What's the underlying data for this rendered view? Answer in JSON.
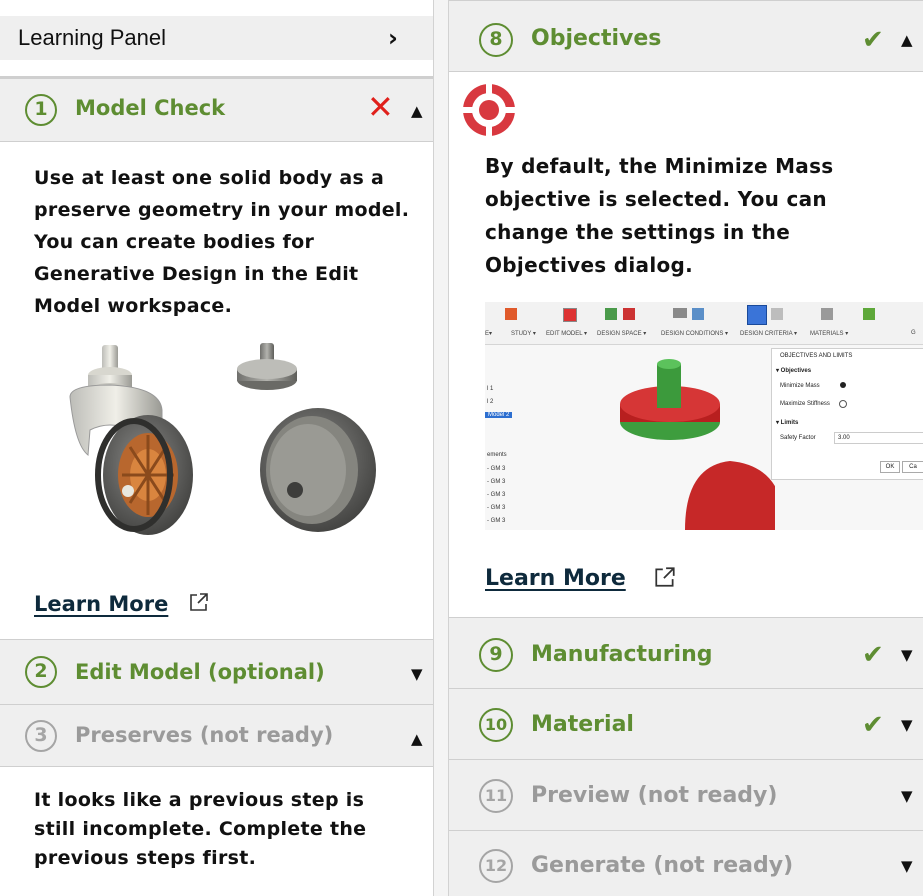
{
  "left": {
    "learning_panel_label": "Learning Panel",
    "model_check": {
      "number": "1",
      "title": "Model Check",
      "text": "Use at least one solid body as a preserve geometry in your model. You can create bodies for Generative Design in the Edit Model workspace.",
      "learn_more": "Learn More"
    },
    "edit_model": {
      "number": "2",
      "title": "Edit Model (optional)"
    },
    "preserves": {
      "number": "3",
      "title": "Preserves (not ready)",
      "text": "It looks like a previous step is still incomplete. Complete the previous steps first."
    }
  },
  "right": {
    "objectives": {
      "number": "8",
      "title": "Objectives",
      "text": "By default, the Minimize Mass objective is selected. You can change the settings in the Objectives dialog.",
      "learn_more": "Learn More",
      "screenshot": {
        "toolbar_labels": [
          "E▾",
          "STUDY ▾",
          "EDIT MODEL ▾",
          "DESIGN SPACE ▾",
          "DESIGN CONDITIONS ▾",
          "DESIGN CRITERIA ▾",
          "MATERIALS ▾",
          "G"
        ],
        "browser_items": [
          "l 1",
          "l 2",
          "Model 2",
          "ements",
          "- GM 3",
          "- GM 3",
          "- GM 3",
          "- GM 3",
          "- GM 3"
        ],
        "dialog": {
          "title": "OBJECTIVES AND LIMITS",
          "objectives_header": "▾ Objectives",
          "opt_minimize_mass": "Minimize Mass",
          "opt_maximize_stiffness": "Maximize Stiffness",
          "limits_header": "▾ Limits",
          "safety_factor_label": "Safety Factor",
          "safety_factor_value": "3.00",
          "ok": "OK",
          "cancel": "Ca"
        }
      }
    },
    "manufacturing": {
      "number": "9",
      "title": "Manufacturing"
    },
    "material": {
      "number": "10",
      "title": "Material"
    },
    "preview": {
      "number": "11",
      "title": "Preview (not ready)"
    },
    "generate": {
      "number": "12",
      "title": "Generate (not ready)"
    }
  },
  "colors": {
    "green": "#5e8d32",
    "grey": "#9a9a9a",
    "error_red": "#e0201b",
    "header_bg": "#efefef",
    "link": "#0e2a3c"
  },
  "icons": {
    "chevron": "chevron-right-icon",
    "error": "x-icon",
    "check": "check-icon",
    "expand": "triangle-up-icon",
    "collapse": "triangle-down-icon",
    "objective": "target-icon",
    "external": "external-link-icon"
  }
}
